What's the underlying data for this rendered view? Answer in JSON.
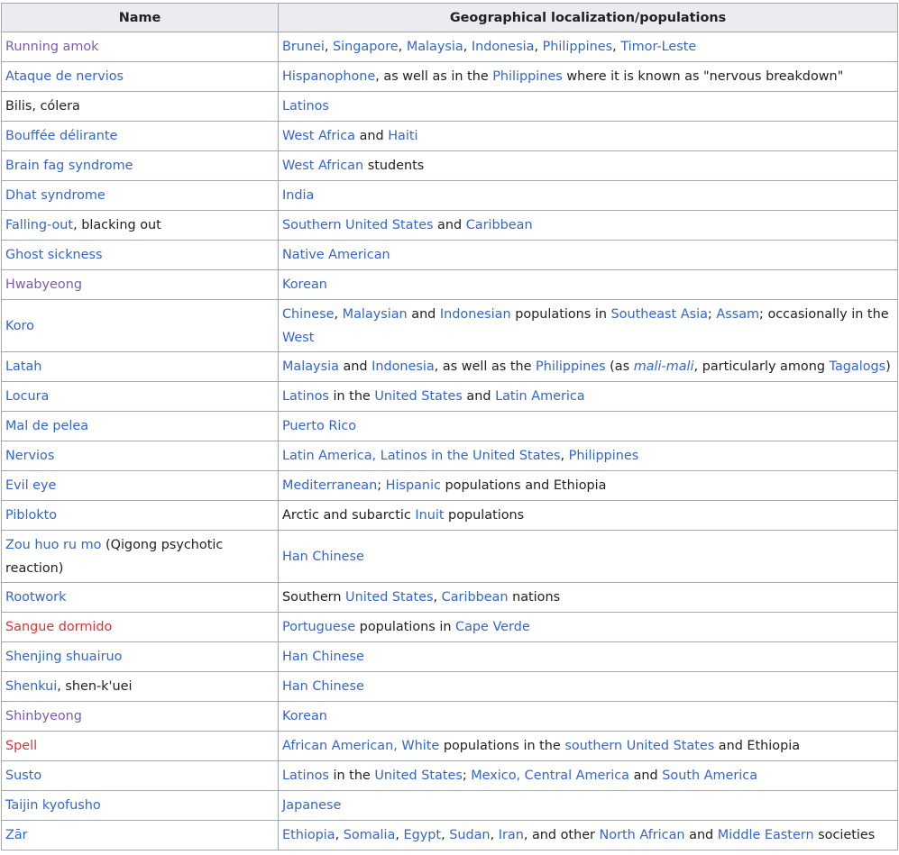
{
  "headers": [
    "Name",
    "Geographical localization/populations"
  ],
  "rows": [
    {
      "name": [
        {
          "t": "Running amok",
          "k": "visited"
        }
      ],
      "geo": [
        {
          "t": "Brunei",
          "k": "link"
        },
        {
          "t": ", ",
          "k": "plain"
        },
        {
          "t": "Singapore",
          "k": "link"
        },
        {
          "t": ", ",
          "k": "plain"
        },
        {
          "t": "Malaysia",
          "k": "link"
        },
        {
          "t": ", ",
          "k": "plain"
        },
        {
          "t": "Indonesia",
          "k": "link"
        },
        {
          "t": ", ",
          "k": "plain"
        },
        {
          "t": "Philippines",
          "k": "link"
        },
        {
          "t": ", ",
          "k": "plain"
        },
        {
          "t": "Timor-Leste",
          "k": "link"
        }
      ]
    },
    {
      "name": [
        {
          "t": "Ataque de nervios",
          "k": "link"
        }
      ],
      "geo": [
        {
          "t": "Hispanophone",
          "k": "link"
        },
        {
          "t": ", as well as in the ",
          "k": "plain"
        },
        {
          "t": "Philippines",
          "k": "link"
        },
        {
          "t": " where it is known as \"nervous breakdown\"",
          "k": "plain"
        }
      ]
    },
    {
      "name": [
        {
          "t": "Bilis, cólera",
          "k": "plain"
        }
      ],
      "geo": [
        {
          "t": "Latinos",
          "k": "link"
        }
      ]
    },
    {
      "name": [
        {
          "t": "Bouffée délirante",
          "k": "link"
        }
      ],
      "geo": [
        {
          "t": "West Africa",
          "k": "link"
        },
        {
          "t": " and ",
          "k": "plain"
        },
        {
          "t": "Haiti",
          "k": "link"
        }
      ]
    },
    {
      "name": [
        {
          "t": "Brain fag syndrome",
          "k": "link"
        }
      ],
      "geo": [
        {
          "t": "West African",
          "k": "link"
        },
        {
          "t": " students",
          "k": "plain"
        }
      ]
    },
    {
      "name": [
        {
          "t": "Dhat syndrome",
          "k": "link"
        }
      ],
      "geo": [
        {
          "t": "India",
          "k": "link"
        }
      ]
    },
    {
      "name": [
        {
          "t": "Falling-out",
          "k": "link"
        },
        {
          "t": ", blacking out",
          "k": "plain"
        }
      ],
      "geo": [
        {
          "t": "Southern United States",
          "k": "link"
        },
        {
          "t": " and ",
          "k": "plain"
        },
        {
          "t": "Caribbean",
          "k": "link"
        }
      ]
    },
    {
      "name": [
        {
          "t": "Ghost sickness",
          "k": "link"
        }
      ],
      "geo": [
        {
          "t": "Native American",
          "k": "link"
        }
      ]
    },
    {
      "name": [
        {
          "t": "Hwabyeong",
          "k": "visited"
        }
      ],
      "geo": [
        {
          "t": "Korean",
          "k": "link"
        }
      ]
    },
    {
      "name": [
        {
          "t": "Koro",
          "k": "link"
        }
      ],
      "tall": true,
      "geo": [
        {
          "t": "Chinese",
          "k": "link"
        },
        {
          "t": ", ",
          "k": "plain"
        },
        {
          "t": "Malaysian",
          "k": "link"
        },
        {
          "t": " and ",
          "k": "plain"
        },
        {
          "t": "Indonesian",
          "k": "link"
        },
        {
          "t": " populations in ",
          "k": "plain"
        },
        {
          "t": "Southeast Asia",
          "k": "link"
        },
        {
          "t": "; ",
          "k": "plain"
        },
        {
          "t": "Assam",
          "k": "link"
        },
        {
          "t": "; occasionally in the ",
          "k": "plain"
        },
        {
          "t": "West",
          "k": "link"
        }
      ]
    },
    {
      "name": [
        {
          "t": "Latah",
          "k": "link"
        }
      ],
      "geo": [
        {
          "t": "Malaysia",
          "k": "link"
        },
        {
          "t": " and ",
          "k": "plain"
        },
        {
          "t": "Indonesia",
          "k": "link"
        },
        {
          "t": ", as well as the ",
          "k": "plain"
        },
        {
          "t": "Philippines",
          "k": "link"
        },
        {
          "t": " (as ",
          "k": "plain"
        },
        {
          "t": "mali-mali",
          "k": "link it"
        },
        {
          "t": ", particularly among ",
          "k": "plain"
        },
        {
          "t": "Tagalogs",
          "k": "link"
        },
        {
          "t": ")",
          "k": "plain"
        }
      ]
    },
    {
      "name": [
        {
          "t": "Locura",
          "k": "link"
        }
      ],
      "geo": [
        {
          "t": "Latinos",
          "k": "link"
        },
        {
          "t": " in the ",
          "k": "plain"
        },
        {
          "t": "United States",
          "k": "link"
        },
        {
          "t": " and ",
          "k": "plain"
        },
        {
          "t": "Latin America",
          "k": "link"
        }
      ]
    },
    {
      "name": [
        {
          "t": "Mal de pelea",
          "k": "link"
        }
      ],
      "geo": [
        {
          "t": "Puerto Rico",
          "k": "link"
        }
      ]
    },
    {
      "name": [
        {
          "t": "Nervios",
          "k": "link"
        }
      ],
      "geo": [
        {
          "t": "Latin America",
          "k": "link"
        },
        {
          "t": ", ",
          "k": "link"
        },
        {
          "t": "Latinos in the United States",
          "k": "link"
        },
        {
          "t": ", ",
          "k": "plain"
        },
        {
          "t": "Philippines",
          "k": "link"
        }
      ]
    },
    {
      "name": [
        {
          "t": "Evil eye",
          "k": "link"
        }
      ],
      "geo": [
        {
          "t": "Mediterranean",
          "k": "link"
        },
        {
          "t": "; ",
          "k": "plain"
        },
        {
          "t": "Hispanic",
          "k": "link"
        },
        {
          "t": " populations and Ethiopia",
          "k": "plain"
        }
      ]
    },
    {
      "name": [
        {
          "t": "Piblokto",
          "k": "link"
        }
      ],
      "geo": [
        {
          "t": "Arctic and subarctic ",
          "k": "plain"
        },
        {
          "t": "Inuit",
          "k": "link"
        },
        {
          "t": " populations",
          "k": "plain"
        }
      ]
    },
    {
      "name": [
        {
          "t": "Zou huo ru mo",
          "k": "link"
        },
        {
          "t": " (Qigong psychotic reaction)",
          "k": "plain"
        }
      ],
      "tall": true,
      "geo": [
        {
          "t": "Han Chinese",
          "k": "link"
        }
      ]
    },
    {
      "name": [
        {
          "t": "Rootwork",
          "k": "link"
        }
      ],
      "geo": [
        {
          "t": "Southern ",
          "k": "plain"
        },
        {
          "t": "United States",
          "k": "link"
        },
        {
          "t": ", ",
          "k": "plain"
        },
        {
          "t": "Caribbean",
          "k": "link"
        },
        {
          "t": " nations",
          "k": "plain"
        }
      ]
    },
    {
      "name": [
        {
          "t": "Sangue dormido",
          "k": "new"
        }
      ],
      "geo": [
        {
          "t": "Portuguese",
          "k": "link"
        },
        {
          "t": " populations in ",
          "k": "plain"
        },
        {
          "t": "Cape Verde",
          "k": "link"
        }
      ]
    },
    {
      "name": [
        {
          "t": "Shenjing shuairuo",
          "k": "link"
        }
      ],
      "geo": [
        {
          "t": "Han Chinese",
          "k": "link"
        }
      ]
    },
    {
      "name": [
        {
          "t": "Shenkui",
          "k": "link"
        },
        {
          "t": ", shen-k'uei",
          "k": "plain"
        }
      ],
      "geo": [
        {
          "t": "Han Chinese",
          "k": "link"
        }
      ]
    },
    {
      "name": [
        {
          "t": "Shinbyeong",
          "k": "visited"
        }
      ],
      "geo": [
        {
          "t": "Korean",
          "k": "link"
        }
      ]
    },
    {
      "name": [
        {
          "t": "Spell",
          "k": "new"
        }
      ],
      "geo": [
        {
          "t": "African American",
          "k": "link"
        },
        {
          "t": ", ",
          "k": "link"
        },
        {
          "t": "White",
          "k": "link"
        },
        {
          "t": " populations in the ",
          "k": "plain"
        },
        {
          "t": "southern United States",
          "k": "link"
        },
        {
          "t": " and Ethiopia",
          "k": "plain"
        }
      ]
    },
    {
      "name": [
        {
          "t": "Susto",
          "k": "link"
        }
      ],
      "geo": [
        {
          "t": "Latinos",
          "k": "link"
        },
        {
          "t": " in the ",
          "k": "plain"
        },
        {
          "t": "United States",
          "k": "link"
        },
        {
          "t": "; ",
          "k": "plain"
        },
        {
          "t": "Mexico",
          "k": "link"
        },
        {
          "t": ", ",
          "k": "link"
        },
        {
          "t": "Central America",
          "k": "link"
        },
        {
          "t": " and ",
          "k": "plain"
        },
        {
          "t": "South America",
          "k": "link"
        }
      ]
    },
    {
      "name": [
        {
          "t": "Taijin kyofusho",
          "k": "link"
        }
      ],
      "geo": [
        {
          "t": "Japanese",
          "k": "link"
        }
      ]
    },
    {
      "name": [
        {
          "t": "Zār",
          "k": "link"
        }
      ],
      "geo": [
        {
          "t": "Ethiopia",
          "k": "link"
        },
        {
          "t": ", ",
          "k": "plain"
        },
        {
          "t": "Somalia",
          "k": "link"
        },
        {
          "t": ", ",
          "k": "plain"
        },
        {
          "t": "Egypt",
          "k": "link"
        },
        {
          "t": ", ",
          "k": "plain"
        },
        {
          "t": "Sudan",
          "k": "link"
        },
        {
          "t": ", ",
          "k": "plain"
        },
        {
          "t": "Iran",
          "k": "link"
        },
        {
          "t": ", and other ",
          "k": "plain"
        },
        {
          "t": "North African",
          "k": "link"
        },
        {
          "t": " and ",
          "k": "plain"
        },
        {
          "t": "Middle Eastern",
          "k": "link"
        },
        {
          "t": " societies",
          "k": "plain"
        }
      ]
    }
  ]
}
